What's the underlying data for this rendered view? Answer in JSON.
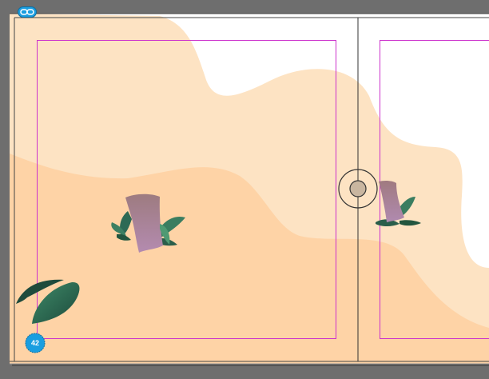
{
  "colors": {
    "pasteboard": "#6e6e6e",
    "page_white": "#ffffff",
    "sand_light": "#fde3c3",
    "sand_dark": "#fed3a6",
    "margin_guide": "#cc33cc",
    "badge": "#1a9ee0",
    "leaf_dark": "#1f4b3c",
    "stump": "#a08090"
  },
  "icons": {
    "top_left": "link-icon",
    "center_control": "target-reference-point-icon"
  },
  "page_badge": {
    "number": "42"
  }
}
